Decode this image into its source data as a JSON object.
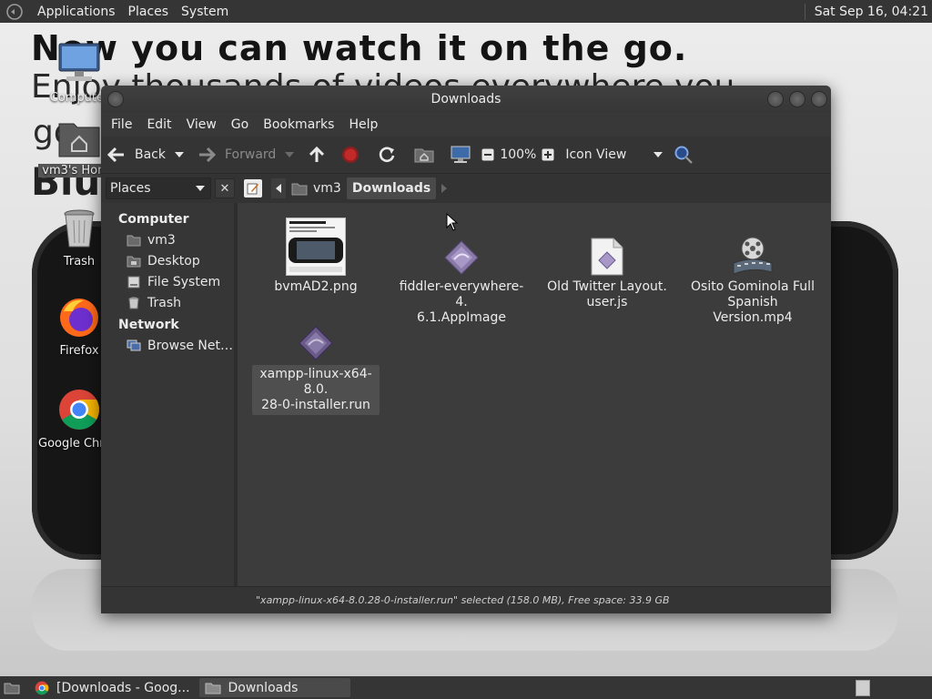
{
  "top_panel": {
    "menus": [
      "Applications",
      "Places",
      "System"
    ],
    "clock": "Sat Sep 16, 04:21"
  },
  "wallpaper": {
    "headline": "Now you can watch it on the go.",
    "sub_fragment": "Enjoy thousands of videos everywhere you",
    "sub_fragment2": "go",
    "fragment3": "Blu"
  },
  "desktop_icons": [
    {
      "name": "computer",
      "label": "Computer"
    },
    {
      "name": "home",
      "label": "vm3's Home"
    },
    {
      "name": "trash",
      "label": "Trash"
    },
    {
      "name": "firefox",
      "label": "Firefox"
    },
    {
      "name": "chrome",
      "label": "Google Chrome"
    }
  ],
  "window": {
    "title": "Downloads",
    "menu": [
      "File",
      "Edit",
      "View",
      "Go",
      "Bookmarks",
      "Help"
    ],
    "toolbar": {
      "back": "Back",
      "forward": "Forward",
      "zoom": "100%",
      "view_mode": "Icon View"
    },
    "location": {
      "places_label": "Places",
      "crumbs": [
        "vm3",
        "Downloads"
      ]
    },
    "sidebar": {
      "computer_heading": "Computer",
      "computer_items": [
        "vm3",
        "Desktop",
        "File System",
        "Trash"
      ],
      "network_heading": "Network",
      "network_items": [
        "Browse Net…"
      ]
    },
    "files": [
      {
        "name": "bvmAD2.png",
        "icon": "image-thumbnail",
        "selected": false
      },
      {
        "name": "fiddler-everywhere-4.6.1.AppImage",
        "icon": "executable-icon",
        "selected": false
      },
      {
        "name": "Old Twitter Layout.user.js",
        "icon": "script-icon",
        "selected": false
      },
      {
        "name": "Osito Gominola Full Spanish Version.mp4",
        "icon": "video-icon",
        "selected": false
      },
      {
        "name": "xampp-linux-x64-8.0.28-0-installer.run",
        "icon": "executable-icon",
        "selected": true
      }
    ],
    "file_lines": [
      [
        "bvmAD2.png"
      ],
      [
        "fiddler-everywhere-4.",
        "6.1.AppImage"
      ],
      [
        "Old Twitter Layout.",
        "user.js"
      ],
      [
        "Osito Gominola Full",
        "Spanish Version.mp4"
      ],
      [
        "xampp-linux-x64-8.0.",
        "28-0-installer.run"
      ]
    ],
    "status": "\"xampp-linux-x64-8.0.28-0-installer.run\" selected (158.0 MB), Free space: 33.9 GB"
  },
  "bottom_panel": {
    "tasks": [
      "[Downloads - Goog...",
      "Downloads"
    ]
  }
}
